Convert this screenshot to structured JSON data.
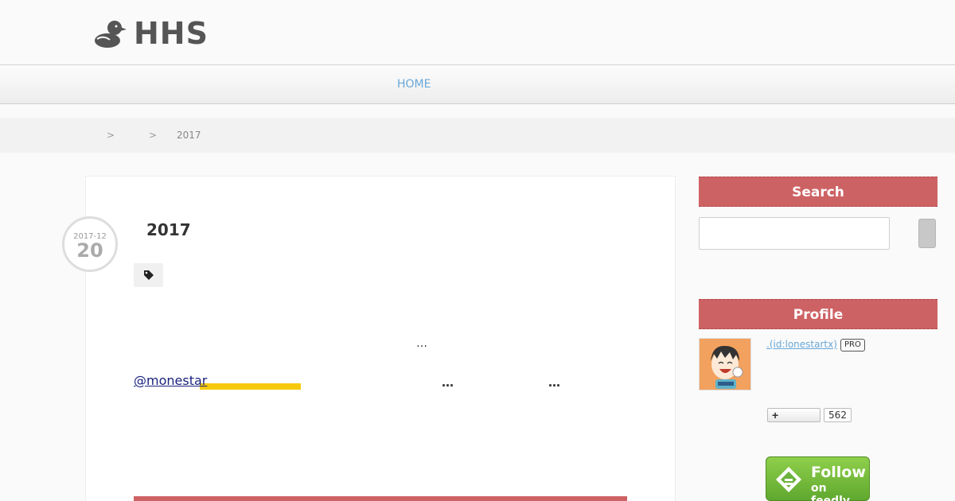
{
  "site": {
    "title": "HHS",
    "logo_icon": "duck-icon"
  },
  "nav": {
    "home_label": "HOME"
  },
  "breadcrumb": {
    "sep": ">",
    "current": "2017"
  },
  "entry": {
    "date_ym": "2017-12",
    "date_day": "20",
    "title": "2017",
    "tag_icon": "tag-icon",
    "ellipsis_1": "…",
    "mention": "@monestar",
    "ellipsis_2": "…",
    "ellipsis_3": "…"
  },
  "sidebar": {
    "search_title": "Search",
    "search_placeholder": "",
    "profile_title": "Profile",
    "profile_id": ".(id:lonestartx)",
    "pro_badge": "PRO",
    "subscribe_plus": "+",
    "subscribe_count": "562",
    "feedly_follow": "Follow",
    "feedly_on": "on feedly"
  },
  "colors": {
    "accent": "#cd6264",
    "link": "#6aa8d8",
    "marker": "#f7c90d",
    "feedly_green": "#6cb33e"
  }
}
